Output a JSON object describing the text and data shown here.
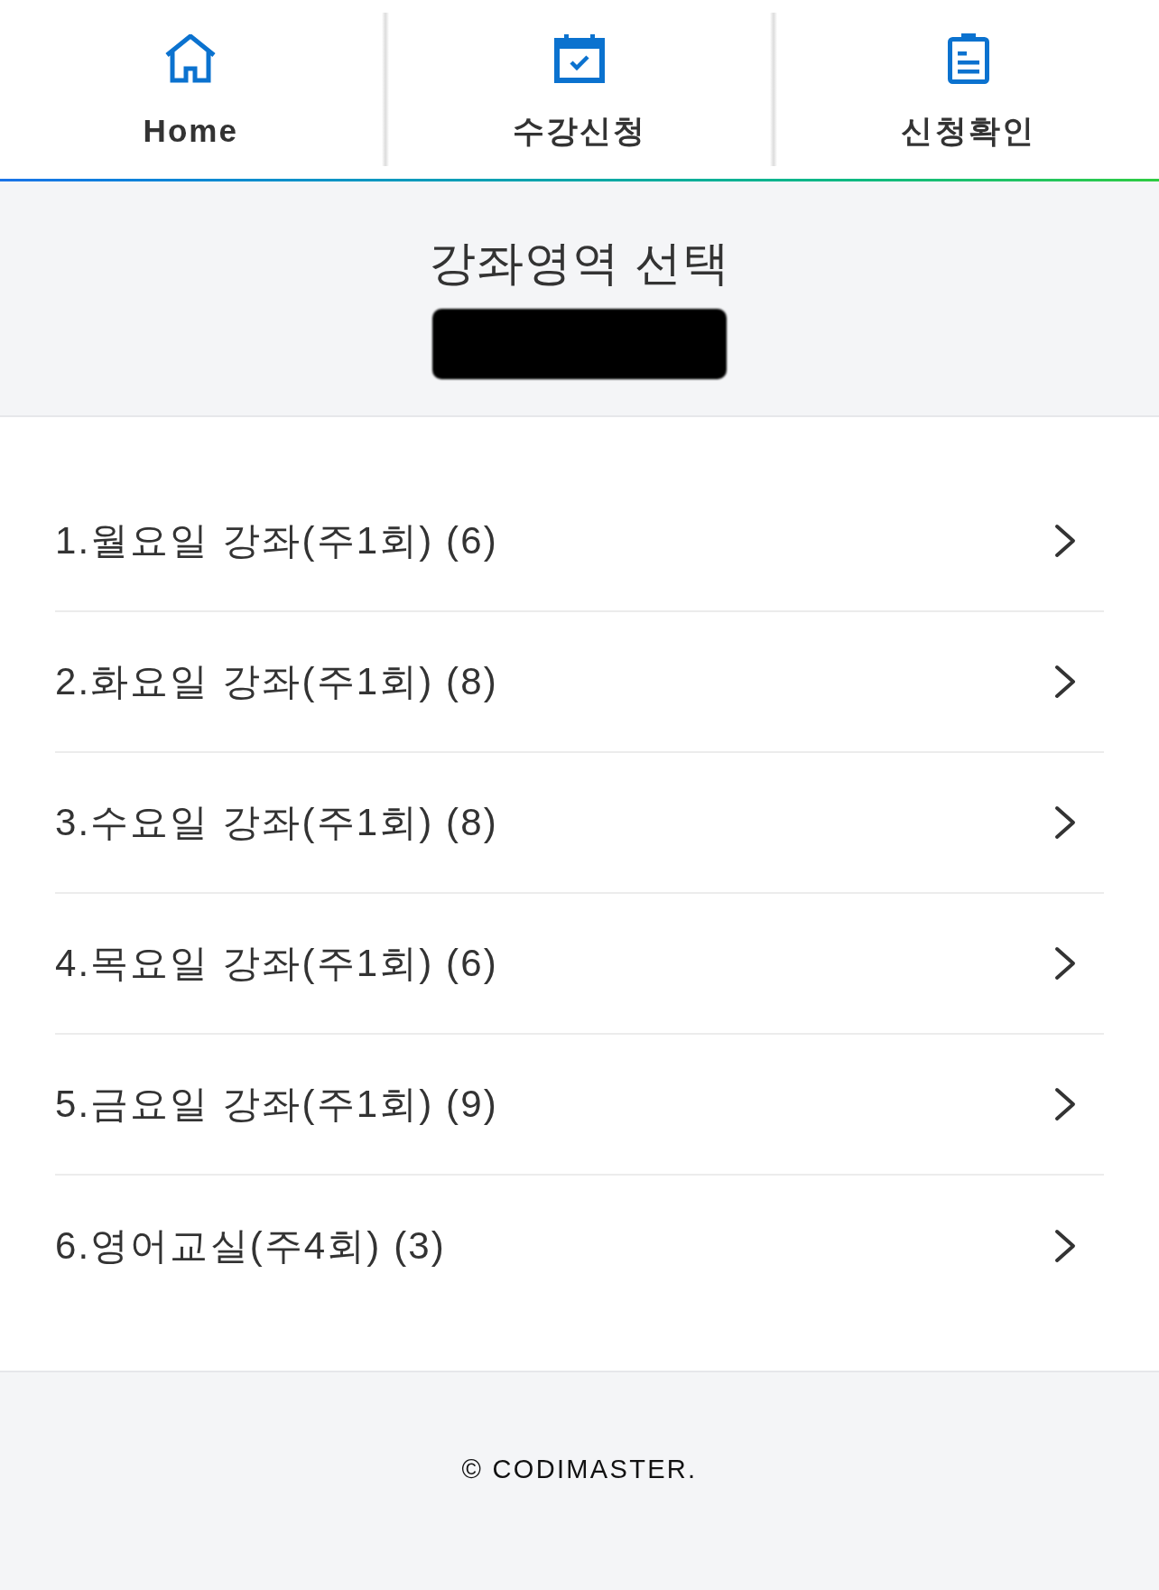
{
  "nav": {
    "tabs": [
      {
        "label": "Home"
      },
      {
        "label": "수강신청"
      },
      {
        "label": "신청확인"
      }
    ]
  },
  "header": {
    "title": "강좌영역 선택"
  },
  "course_areas": [
    {
      "label": "1.월요일 강좌(주1회) (6)"
    },
    {
      "label": "2.화요일 강좌(주1회) (8)"
    },
    {
      "label": "3.수요일 강좌(주1회) (8)"
    },
    {
      "label": "4.목요일 강좌(주1회) (6)"
    },
    {
      "label": "5.금요일 강좌(주1회) (9)"
    },
    {
      "label": "6.영어교실(주4회) (3)"
    }
  ],
  "footer": {
    "copyright": "© CODIMASTER."
  }
}
